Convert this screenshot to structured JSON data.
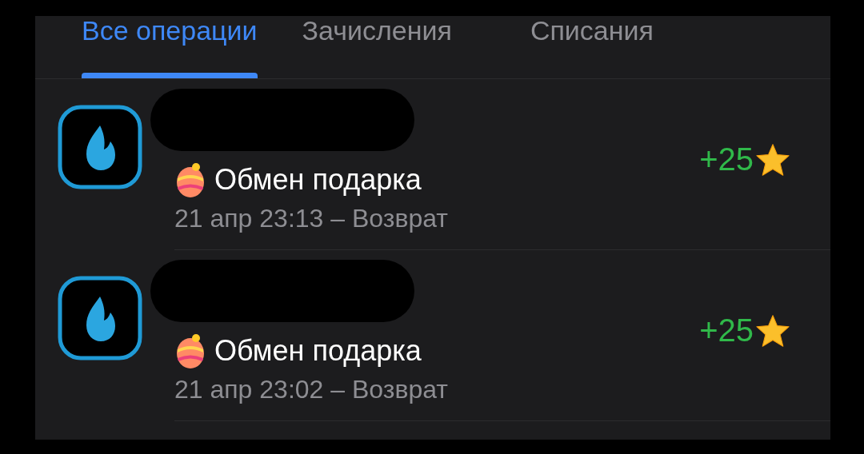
{
  "tabs": [
    {
      "label": "Все операции",
      "selected": true
    },
    {
      "label": "Зачисления",
      "selected": false
    },
    {
      "label": "Списания",
      "selected": false
    }
  ],
  "transactions": [
    {
      "title": "Обмен подарка",
      "subtitle": "21 апр 23:13 – Возврат",
      "amount": "+25"
    },
    {
      "title": "Обмен подарка",
      "subtitle": "21 апр 23:02 – Возврат",
      "amount": "+25"
    }
  ]
}
